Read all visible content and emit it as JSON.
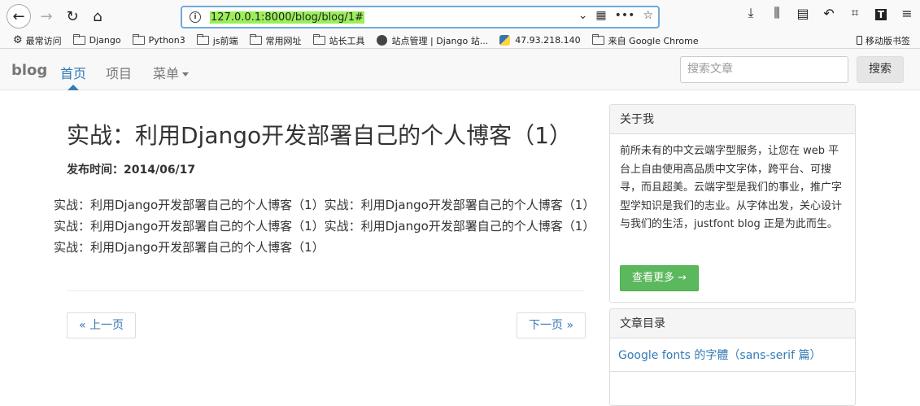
{
  "browser": {
    "url": "127.0.0.1:8000/blog/blog/1#",
    "bookmarks": [
      {
        "label": "最常访问",
        "icon": "gear-icon"
      },
      {
        "label": "Django",
        "icon": "folder-icon"
      },
      {
        "label": "Python3",
        "icon": "folder-icon"
      },
      {
        "label": "js前端",
        "icon": "folder-icon"
      },
      {
        "label": "常用网址",
        "icon": "folder-icon"
      },
      {
        "label": "站长工具",
        "icon": "folder-icon"
      },
      {
        "label": "站点管理 | Django 站...",
        "icon": "globe-icon"
      },
      {
        "label": "47.93.218.140",
        "icon": "python-icon"
      },
      {
        "label": "来自 Google Chrome",
        "icon": "folder-icon"
      }
    ],
    "mobile_bookmarks": "移动版书签"
  },
  "navbar": {
    "brand": "blog",
    "items": [
      {
        "label": "首页"
      },
      {
        "label": "项目"
      },
      {
        "label": "菜单"
      }
    ],
    "search_placeholder": "搜索文章",
    "search_button": "搜索"
  },
  "post": {
    "title": "实战：利用Django开发部署自己的个人博客（1）",
    "date_label": "发布时间：2014/06/17",
    "body": "实战：利用Django开发部署自己的个人博客（1）实战：利用Django开发部署自己的个人博客（1）实战：利用Django开发部署自己的个人博客（1）实战：利用Django开发部署自己的个人博客（1）实战：利用Django开发部署自己的个人博客（1）"
  },
  "pager": {
    "prev": "« 上一页",
    "next": "下一页 »"
  },
  "sidebar": {
    "about": {
      "heading": "关于我",
      "text": "前所未有的中文云端字型服务，让您在 web 平台上自由使用高品质中文字体，跨平台、可搜寻，而且超美。云端字型是我们的事业，推广字型学知识是我们的志业。从字体出发，关心设计与我们的生活，justfont blog 正是为此而生。",
      "button": "查看更多 →"
    },
    "toc": {
      "heading": "文章目录",
      "items": [
        {
          "label": "Google fonts 的字體（sans-serif 篇）"
        }
      ]
    }
  }
}
